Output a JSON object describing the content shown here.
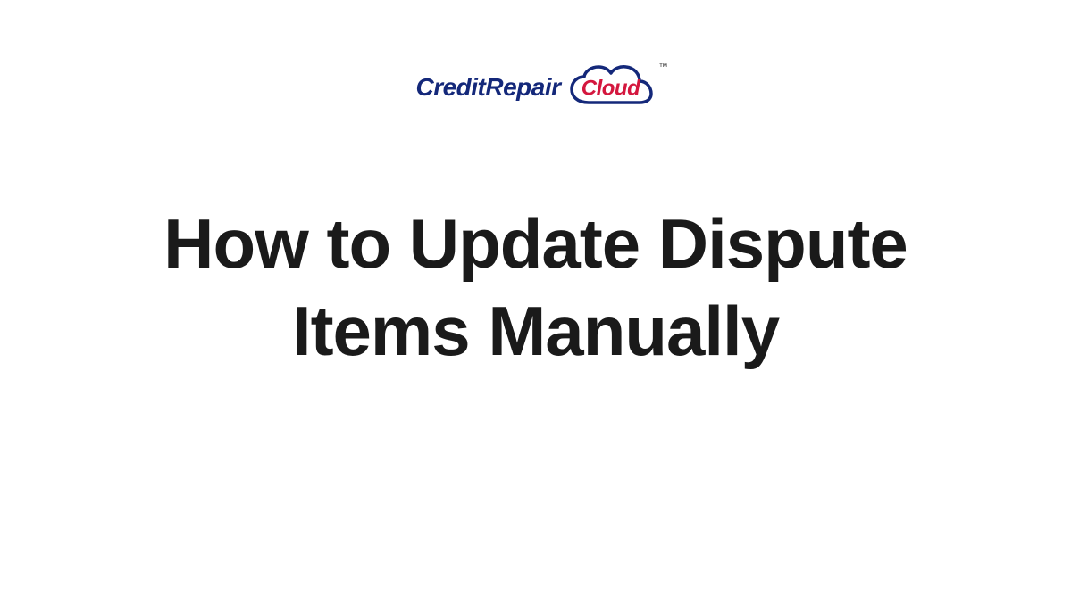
{
  "logo": {
    "text_part1": "CreditRepair",
    "text_part2": "Cloud",
    "trademark": "™"
  },
  "title": "How to Update Dispute Items Manually"
}
